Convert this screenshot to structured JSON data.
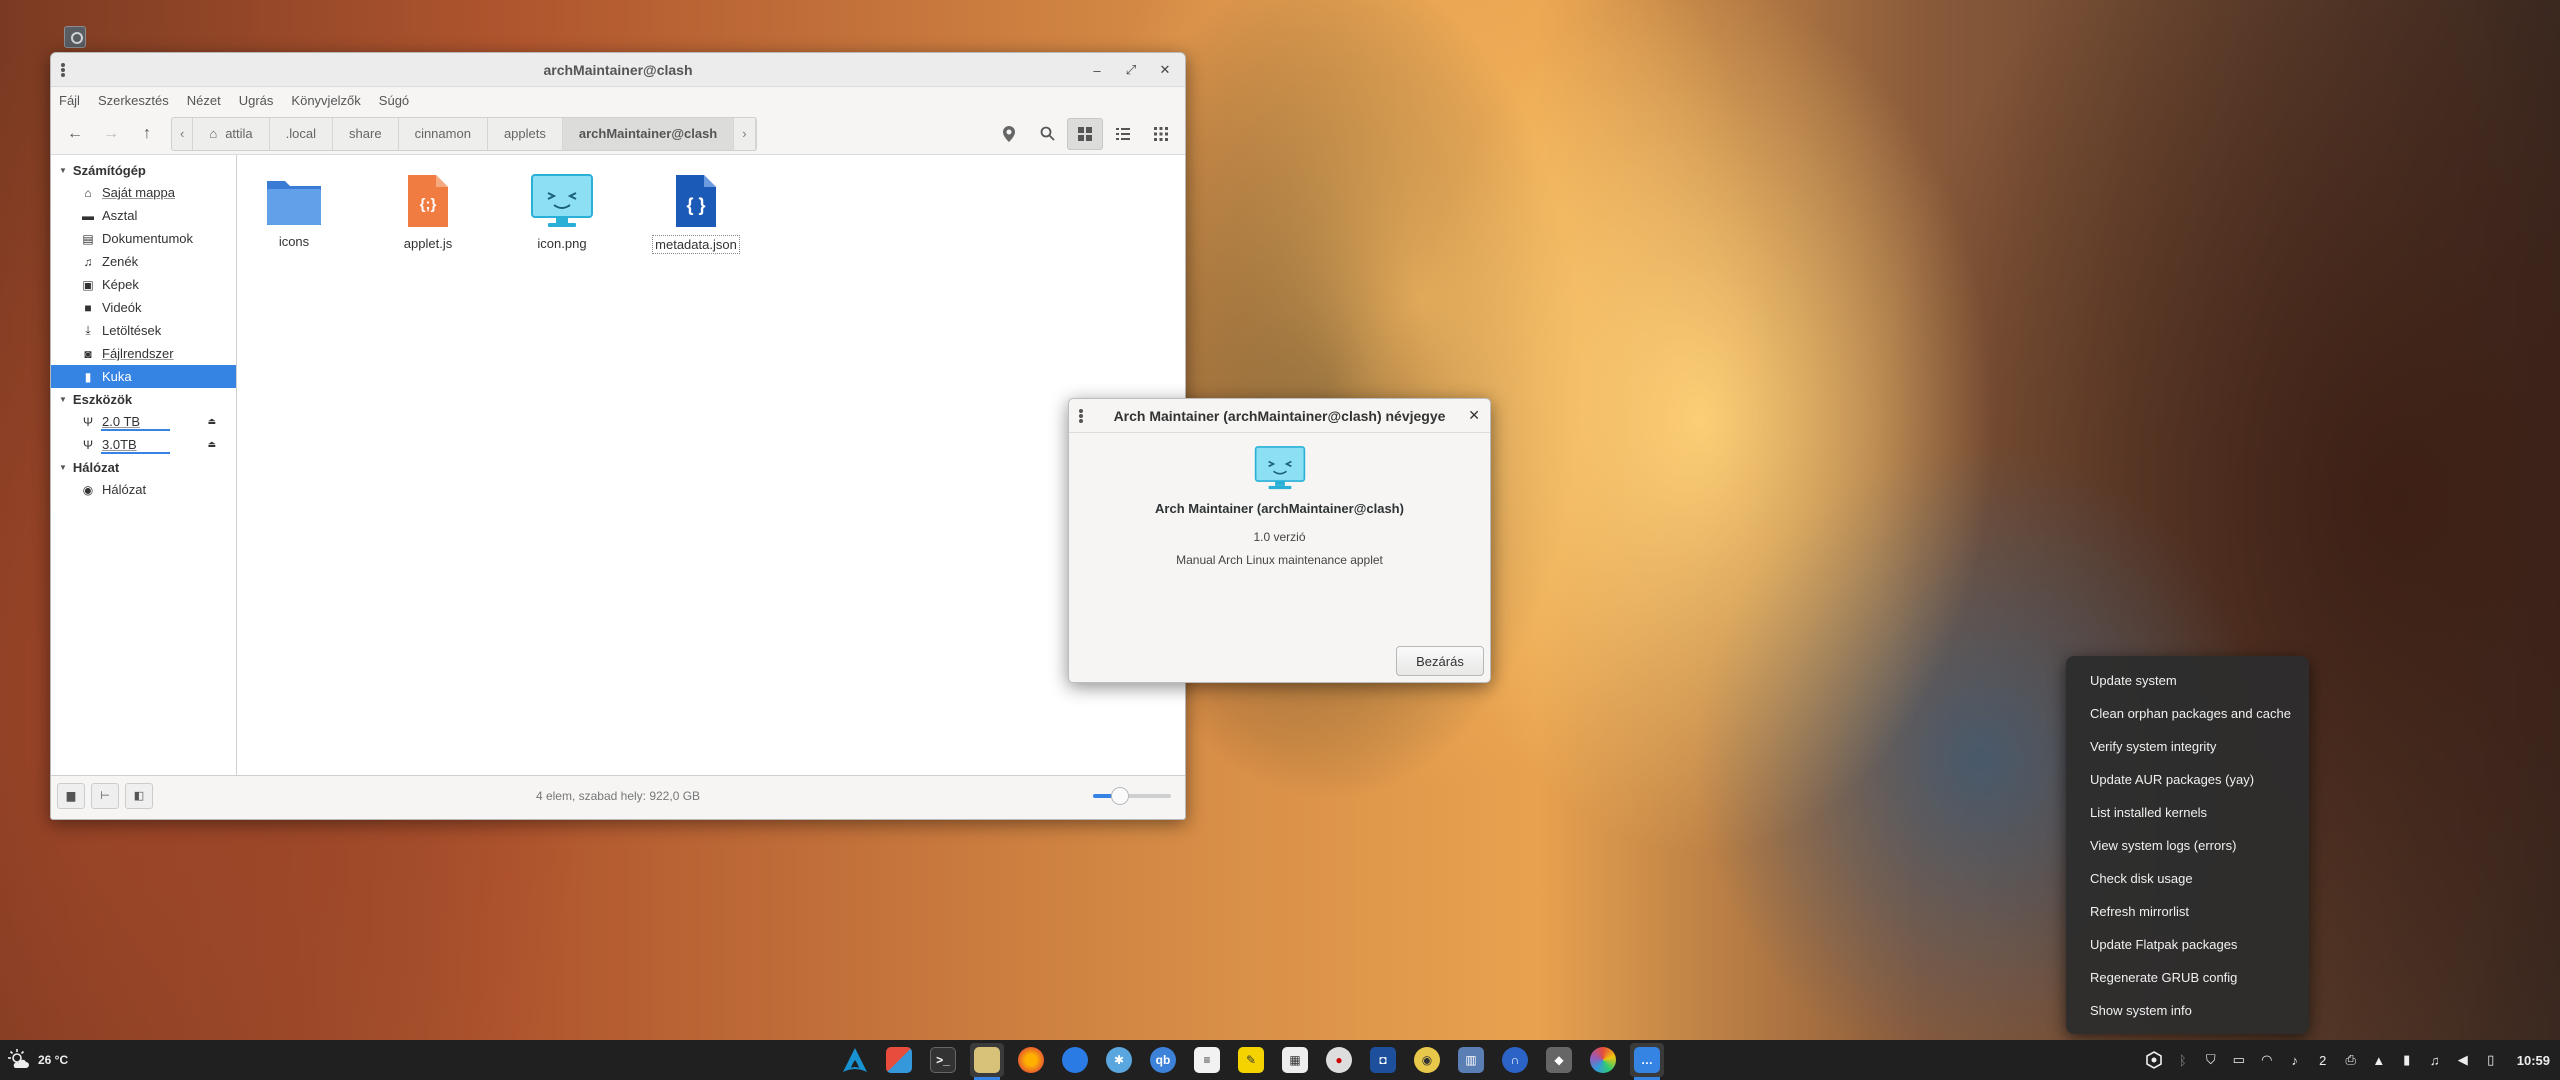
{
  "file_manager": {
    "title": "archMaintainer@clash",
    "menu": [
      "Fájl",
      "Szerkesztés",
      "Nézet",
      "Ugrás",
      "Könyvjelzők",
      "Súgó"
    ],
    "breadcrumbs": [
      "attila",
      ".local",
      "share",
      "cinnamon",
      "applets",
      "archMaintainer@clash"
    ],
    "sidebar": {
      "sections": [
        {
          "title": "Számítógép",
          "items": [
            {
              "label": "Saját mappa",
              "icon": "home-icon"
            },
            {
              "label": "Asztal",
              "icon": "desktop-icon"
            },
            {
              "label": "Dokumentumok",
              "icon": "documents-icon"
            },
            {
              "label": "Zenék",
              "icon": "music-icon"
            },
            {
              "label": "Képek",
              "icon": "pictures-icon"
            },
            {
              "label": "Videók",
              "icon": "videos-icon"
            },
            {
              "label": "Letöltések",
              "icon": "downloads-icon"
            },
            {
              "label": "Fájlrendszer",
              "icon": "filesystem-icon"
            },
            {
              "label": "Kuka",
              "icon": "trash-icon",
              "selected": true
            }
          ]
        },
        {
          "title": "Eszközök",
          "items": [
            {
              "label": "2.0 TB",
              "icon": "usb-icon",
              "ejectable": true
            },
            {
              "label": "3.0TB",
              "icon": "usb-icon",
              "ejectable": true
            }
          ]
        },
        {
          "title": "Hálózat",
          "items": [
            {
              "label": "Hálózat",
              "icon": "network-icon"
            }
          ]
        }
      ]
    },
    "files": [
      {
        "name": "icons",
        "type": "folder"
      },
      {
        "name": "applet.js",
        "type": "javascript"
      },
      {
        "name": "icon.png",
        "type": "image"
      },
      {
        "name": "metadata.json",
        "type": "json",
        "selected": true
      }
    ],
    "status": "4 elem, szabad hely: 922,0 GB",
    "zoom_level": 0.3
  },
  "about_dialog": {
    "title": "Arch Maintainer (archMaintainer@clash) névjegye",
    "app_name": "Arch Maintainer (archMaintainer@clash)",
    "version": "1.0 verzió",
    "description": "Manual Arch Linux maintenance applet",
    "close_label": "Bezárás"
  },
  "context_menu": {
    "items": [
      "Update system",
      "Clean orphan packages and cache",
      "Verify system integrity",
      "Update AUR packages (yay)",
      "List installed kernels",
      "View system logs (errors)",
      "Check disk usage",
      "Refresh mirrorlist",
      "Update Flatpak packages",
      "Regenerate GRUB config",
      "Show system info"
    ]
  },
  "taskbar": {
    "weather": "26 °C",
    "notification_count": "2",
    "clock": "10:59",
    "accent": "#3584e4"
  }
}
